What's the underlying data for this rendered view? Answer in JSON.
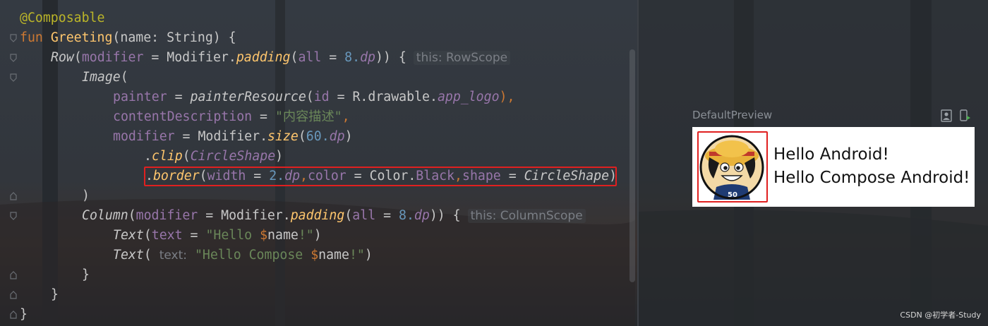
{
  "code": {
    "annotation": "@Composable",
    "l2": {
      "kw": "fun",
      "name": "Greeting",
      "open": "(name: String) {"
    },
    "l3": {
      "fn": "Row",
      "p1": "(",
      "param": "modifier",
      "eq": " = ",
      "mod": "Modifier.",
      "call": "padding",
      "p2": "(",
      "param2": "all",
      "eq2": " = ",
      "num": "8.",
      "ext": "dp",
      "close": ")) {",
      "hint": "this: RowScope"
    },
    "l4": {
      "fn": "Image",
      "p": "("
    },
    "l5": {
      "param": "painter",
      "eq": " = ",
      "fn": "painterResource",
      "p1": "(",
      "param2": "id",
      "eq2": " = ",
      "res": "R.drawable.",
      "id": "app_logo",
      "close": "),",
      "comma": ""
    },
    "l6": {
      "param": "contentDescription",
      "eq": " = ",
      "str": "\"内容描述\"",
      "comma": ","
    },
    "l7": {
      "param": "modifier",
      "eq": " = ",
      "mod": "Modifier.",
      "call": "size",
      "p1": "(",
      "num": "60.",
      "ext": "dp",
      "close": ")"
    },
    "l8": {
      "dot": ".",
      "call": "clip",
      "p1": "(",
      "shape": "CircleShape",
      "close": ")"
    },
    "l9": {
      "dot": ".",
      "call": "border",
      "p1": "(",
      "param": "width",
      "eq": " = ",
      "num": "2.",
      "ext": "dp",
      "c1": ",",
      "param2": "color",
      "eq2": " = ",
      "col": "Color.",
      "black": "Black",
      "c2": ",",
      "param3": "shape",
      "eq3": " = ",
      "shape": "CircleShape",
      "close": ")"
    },
    "l10": ")",
    "l11": {
      "fn": "Column",
      "p1": "(",
      "param": "modifier",
      "eq": " = ",
      "mod": "Modifier.",
      "call": "padding",
      "p2": "(",
      "param2": "all",
      "eq2": " = ",
      "num": "8.",
      "ext": "dp",
      "close": ")) {",
      "hint": "this: ColumnScope"
    },
    "l12": {
      "fn": "Text",
      "p1": "(",
      "param": "text",
      "eq": " = ",
      "s1": "\"Hello ",
      "dollar": "$",
      "name": "name",
      "s2": "!\"",
      "close": ")"
    },
    "l13": {
      "fn": "Text",
      "p1": "( ",
      "hint": "text:",
      "s1": " \"Hello Compose ",
      "dollar": "$",
      "name": "name",
      "s2": "!\"",
      "close": ")"
    },
    "l14": "}",
    "l15": "}",
    "l16": "}"
  },
  "preview": {
    "title": "DefaultPreview",
    "line1": "Hello Android!",
    "line2": "Hello Compose Android!",
    "icons": [
      "deploy-preview-icon",
      "interactive-preview-icon"
    ]
  },
  "watermark": "CSDN @初学者-Study",
  "colors": {
    "keyword": "#cc7832",
    "function": "#ffc66d",
    "annotation": "#bbb529",
    "parameter": "#9876aa",
    "string": "#6a8759",
    "number": "#6897bb",
    "highlight": "#e02020"
  }
}
